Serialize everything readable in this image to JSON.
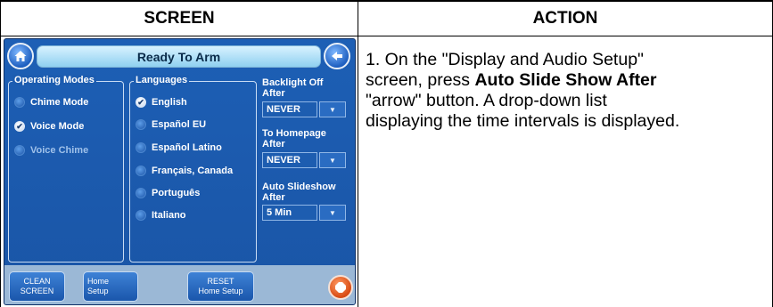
{
  "table": {
    "header_screen": "SCREEN",
    "header_action": "ACTION"
  },
  "screen": {
    "title": "Ready To Arm",
    "operating_modes": {
      "legend": "Operating Modes",
      "options": [
        {
          "label": "Chime Mode",
          "selected": false
        },
        {
          "label": "Voice Mode",
          "selected": true
        },
        {
          "label": "Voice Chime",
          "selected": false
        }
      ]
    },
    "languages": {
      "legend": "Languages",
      "options": [
        {
          "label": "English",
          "selected": true
        },
        {
          "label": "Español EU",
          "selected": false
        },
        {
          "label": "Español Latino",
          "selected": false
        },
        {
          "label": "Français, Canada",
          "selected": false
        },
        {
          "label": "Português",
          "selected": false
        },
        {
          "label": "Italiano",
          "selected": false
        }
      ]
    },
    "backlight": {
      "label_1": "Backlight Off",
      "label_2": "After",
      "value": "NEVER"
    },
    "homepage": {
      "label_1": "To Homepage",
      "label_2": "After",
      "value": "NEVER"
    },
    "slideshow": {
      "label_1": "Auto Slideshow",
      "label_2": "After",
      "value": "5 Min"
    },
    "buttons": {
      "clean_1": "CLEAN",
      "clean_2": "SCREEN",
      "home_1": "Home",
      "home_2": "Setup",
      "reset_1": "RESET",
      "reset_2": "Home Setup"
    },
    "icons": {
      "home": "home-icon",
      "back": "back-arrow-icon",
      "emergency": "emergency-icon",
      "dropdown": "chevron-down-icon",
      "check": "checkmark-icon"
    }
  },
  "action": {
    "line1": "1.  On the \"Display and Audio Setup\"",
    "line2_pre": "screen, press ",
    "line2_bold": "Auto Slide Show After",
    "line3": "\"arrow\" button.  A drop-down list",
    "line4": "displaying the time intervals is displayed."
  }
}
